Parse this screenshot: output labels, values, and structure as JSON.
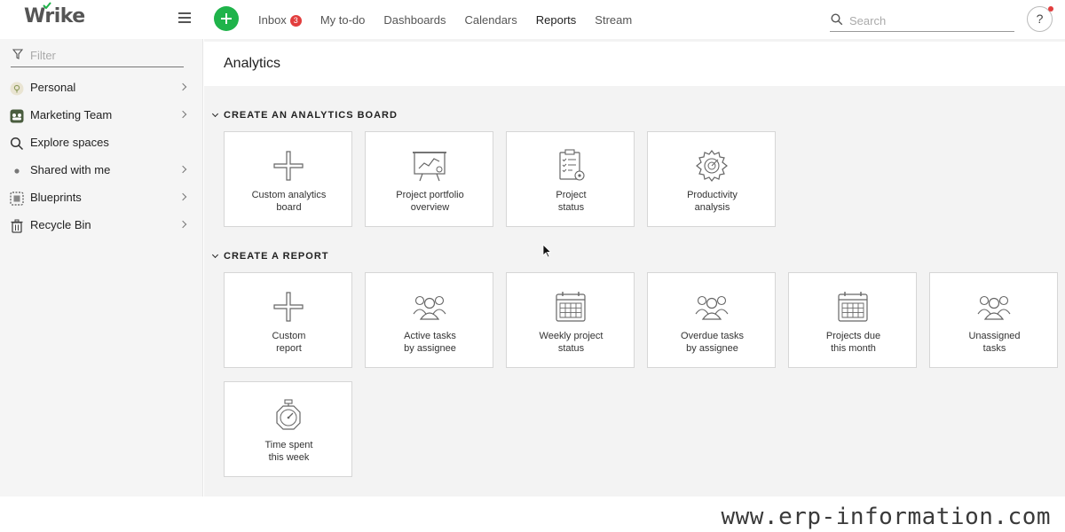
{
  "brand": {
    "name": "Wrike"
  },
  "nav": {
    "items": [
      {
        "label": "Inbox",
        "badge": "3"
      },
      {
        "label": "My to-do"
      },
      {
        "label": "Dashboards"
      },
      {
        "label": "Calendars"
      },
      {
        "label": "Reports",
        "active": true
      },
      {
        "label": "Stream"
      }
    ],
    "search_placeholder": "Search",
    "help_label": "?"
  },
  "sidebar": {
    "filter_placeholder": "Filter",
    "items": [
      {
        "label": "Personal",
        "icon": "personal-space-icon"
      },
      {
        "label": "Marketing Team",
        "icon": "team-space-icon"
      },
      {
        "label": "Explore spaces",
        "icon": "search-icon"
      },
      {
        "label": "Shared with me",
        "icon": "dot-icon"
      },
      {
        "label": "Blueprints",
        "icon": "blueprint-icon"
      },
      {
        "label": "Recycle Bin",
        "icon": "trash-icon"
      }
    ]
  },
  "main": {
    "title": "Analytics",
    "analytics_section": {
      "title": "CREATE AN ANALYTICS BOARD",
      "cards": [
        {
          "label": "Custom analytics\nboard",
          "icon": "plus-icon"
        },
        {
          "label": "Project portfolio\noverview",
          "icon": "presentation-board-icon"
        },
        {
          "label": "Project\nstatus",
          "icon": "clipboard-checklist-icon"
        },
        {
          "label": "Productivity\nanalysis",
          "icon": "gear-target-icon"
        }
      ]
    },
    "report_section": {
      "title": "CREATE A REPORT",
      "cards": [
        {
          "label": "Custom\nreport",
          "icon": "plus-icon"
        },
        {
          "label": "Active tasks\nby assignee",
          "icon": "people-group-icon"
        },
        {
          "label": "Weekly project\nstatus",
          "icon": "calendar-icon"
        },
        {
          "label": "Overdue tasks\nby assignee",
          "icon": "people-group-icon"
        },
        {
          "label": "Projects due\nthis month",
          "icon": "calendar-icon"
        },
        {
          "label": "Unassigned\ntasks",
          "icon": "people-group-icon"
        },
        {
          "label": "Time spent\nthis week",
          "icon": "stopwatch-icon"
        }
      ]
    }
  },
  "watermark": "www.erp-information.com",
  "colors": {
    "accent_green": "#1fb34a",
    "badge_red": "#e23d3d",
    "sidebar_bg": "#f5f5f5",
    "main_bg": "#f3f3f3"
  }
}
